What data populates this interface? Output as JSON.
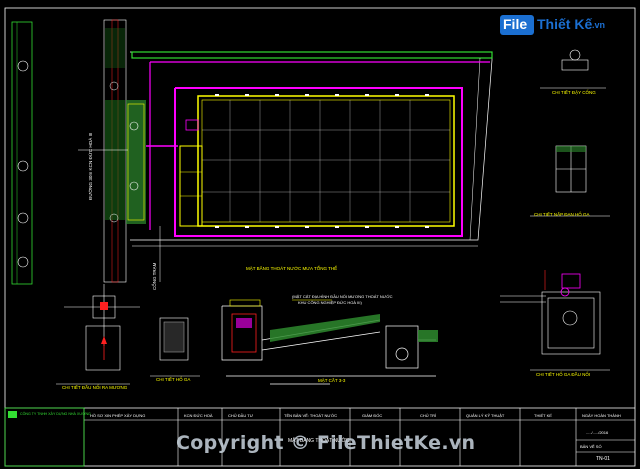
{
  "logo": {
    "part1": "File",
    "part2": "Thiết Kế",
    "part3": ".vn",
    "color_box": "#1b6fd1",
    "color_text": "#1b6fd1",
    "color_accent": "#ff5a1f"
  },
  "drawing": {
    "road_label": "ĐƯỜNG 30m KCN ĐỨC HOÀ III",
    "gate_label": "CỔNG TRẠM",
    "site_plan_label": "MẶT BẰNG THOÁT NƯỚC MƯA TỔNG THỂ",
    "detail_manhole_label": "CHI TIẾT HỐ GA",
    "detail_cover_label": "CHI TIẾT ĐẬY CỐNG",
    "detail_cover_grate_label": "CHI TIẾT NẮP ĐAN HỐ GA",
    "detail_pit_label": "CHI TIẾT HỐ GA ĐẦU NỐI",
    "detail_connection_label": "CHI TIẾT ĐẦU NỐI RA MƯƠNG",
    "section_label": "MẶT CẮT 3-3",
    "section_note1": "(MẶT CẮT ĐỊA HÌNH ĐẦU NỐI MƯƠNG THOÁT NƯỚC",
    "section_note2": "KHU CÔNG NGHIỆP ĐỨC HOÀ III)",
    "colors": {
      "yellow": "#ffff00",
      "magenta": "#ff00ff",
      "green": "#33dd33",
      "cyan": "#00ffff",
      "red": "#ff2020"
    }
  },
  "title_block": {
    "company": "CÔNG TY TNHH XÂY DỰNG NHÀ XƯỞNG",
    "headers": [
      "HỒ SƠ XIN PHÉP XÂY DỰNG",
      "KCN ĐỨC HOÀ",
      "CHỦ ĐẦU TƯ",
      "TÊN BẢN VẼ: THOÁT NƯỚC",
      "GIÁM ĐỐC",
      "CHỦ TRÌ",
      "QUẢN LÝ KỸ THUẬT",
      "THIẾT KẾ",
      "NGÀY HOÀN THÀNH"
    ],
    "drawing_title": "MẶT BẰNG THOÁT NƯỚC",
    "date_value": "...../...../2016",
    "sheet_label": "BẢN VẼ SỐ",
    "sheet_value": "TN-01"
  },
  "watermark": {
    "text": "Copyright © FileThietKe.vn"
  }
}
